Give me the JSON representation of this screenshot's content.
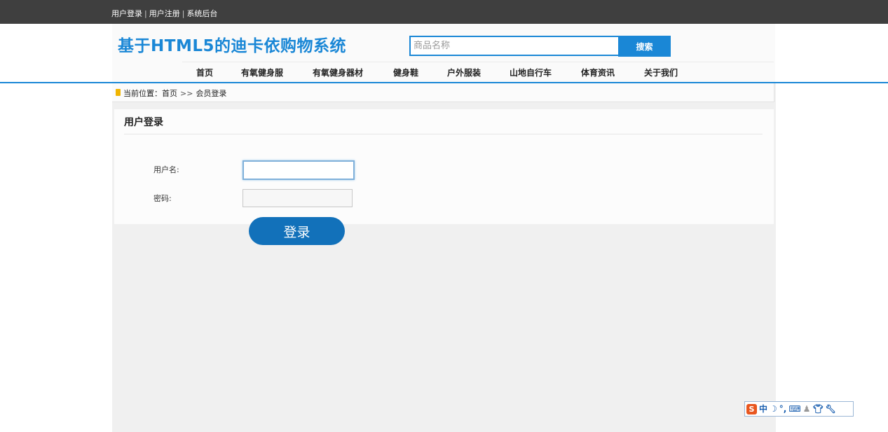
{
  "topbar": {
    "links": [
      "用户登录",
      "用户注册",
      "系统后台"
    ],
    "separator": "|"
  },
  "header": {
    "site_title": "基于HTML5的迪卡依购物系统",
    "search_placeholder": "商品名称",
    "search_button_label": "搜索"
  },
  "nav": {
    "items": [
      "首页",
      "有氧健身服",
      "有氧健身器材",
      "健身鞋",
      "户外服装",
      "山地自行车",
      "体育资讯",
      "关于我们"
    ]
  },
  "breadcrumb": {
    "prefix": "当前位置：",
    "home": "首页",
    "separator": ">>",
    "current": "会员登录"
  },
  "login_panel": {
    "title": "用户登录",
    "username_label": "用户名:",
    "password_label": "密码:",
    "username_value": "",
    "password_value": "",
    "submit_label": "登录"
  },
  "ime_toolbar": {
    "logo": "S",
    "mode": "中",
    "icons": [
      "moon-icon",
      "punctuation-icon",
      "keyboard-icon",
      "user-icon",
      "shirt-icon",
      "wrench-icon"
    ]
  },
  "colors": {
    "accent": "#1a87d6",
    "topbar": "#3f3f3f",
    "login_button": "#1271ba"
  }
}
